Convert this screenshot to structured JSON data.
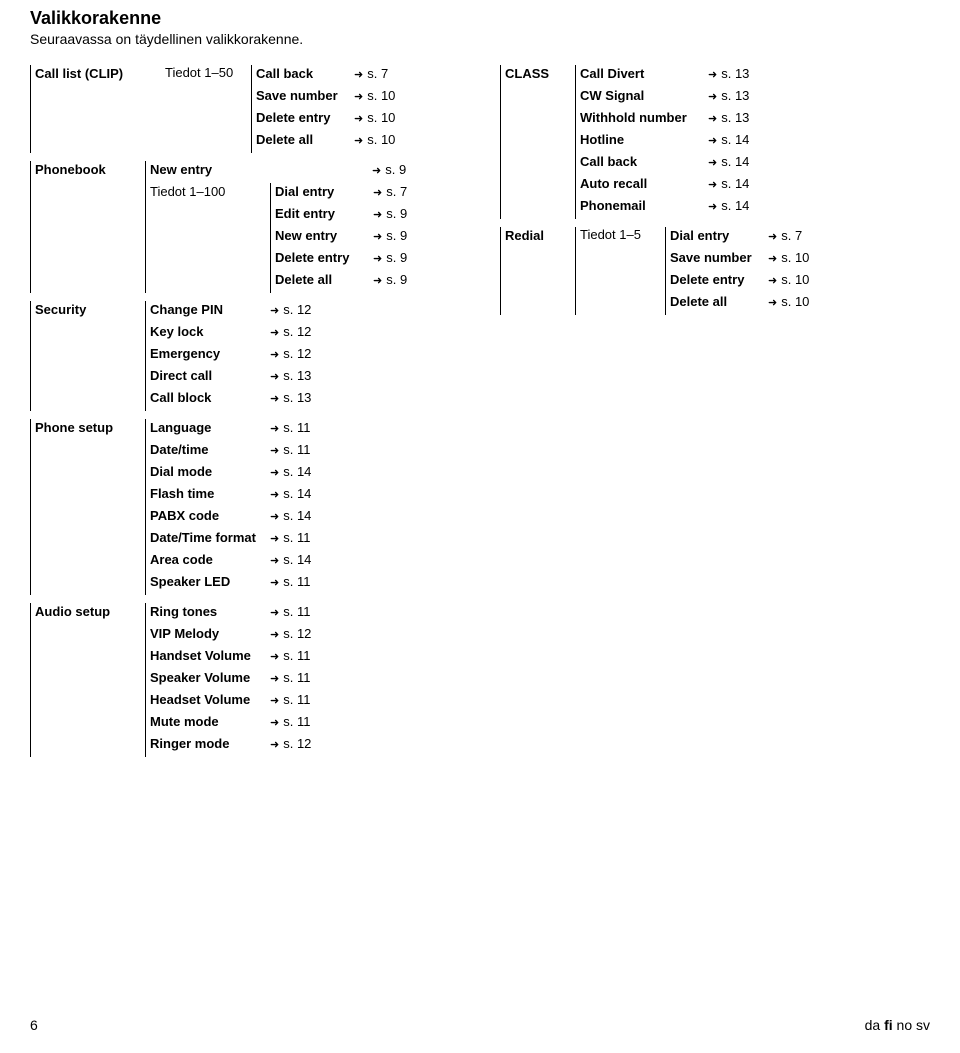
{
  "heading": "Valikkorakenne",
  "subheading": "Seuraavassa on täydellinen valikkorakenne.",
  "left": {
    "callList": {
      "label": "Call list (CLIP)",
      "range": "Tiedot 1–50",
      "items": [
        {
          "label": "Call back",
          "ref": "s. 7"
        },
        {
          "label": "Save number",
          "ref": "s. 10"
        },
        {
          "label": "Delete entry",
          "ref": "s. 10"
        },
        {
          "label": "Delete all",
          "ref": "s. 10"
        }
      ]
    },
    "phonebook": {
      "label": "Phonebook",
      "newEntry": {
        "label": "New entry",
        "ref": "s. 9"
      },
      "range": "Tiedot 1–100",
      "items": [
        {
          "label": "Dial entry",
          "ref": "s. 7"
        },
        {
          "label": "Edit entry",
          "ref": "s. 9"
        },
        {
          "label": "New entry",
          "ref": "s. 9"
        },
        {
          "label": "Delete entry",
          "ref": "s. 9"
        },
        {
          "label": "Delete all",
          "ref": "s. 9"
        }
      ]
    },
    "security": {
      "label": "Security",
      "items": [
        {
          "label": "Change PIN",
          "ref": "s. 12"
        },
        {
          "label": "Key lock",
          "ref": "s. 12"
        },
        {
          "label": "Emergency",
          "ref": "s. 12"
        },
        {
          "label": "Direct call",
          "ref": "s. 13"
        },
        {
          "label": "Call block",
          "ref": "s. 13"
        }
      ]
    },
    "phoneSetup": {
      "label": "Phone setup",
      "items": [
        {
          "label": "Language",
          "ref": "s. 11"
        },
        {
          "label": "Date/time",
          "ref": "s. 11"
        },
        {
          "label": "Dial mode",
          "ref": "s. 14"
        },
        {
          "label": "Flash time",
          "ref": "s. 14"
        },
        {
          "label": "PABX code",
          "ref": "s. 14"
        },
        {
          "label": "Date/Time format",
          "ref": "s. 11"
        },
        {
          "label": "Area code",
          "ref": "s. 14"
        },
        {
          "label": "Speaker LED",
          "ref": "s. 11"
        }
      ]
    },
    "audioSetup": {
      "label": "Audio setup",
      "items": [
        {
          "label": "Ring tones",
          "ref": "s. 11"
        },
        {
          "label": "VIP Melody",
          "ref": "s. 12"
        },
        {
          "label": "Handset Volume",
          "ref": "s. 11"
        },
        {
          "label": "Speaker Volume",
          "ref": "s. 11"
        },
        {
          "label": "Headset Volume",
          "ref": "s. 11"
        },
        {
          "label": "Mute mode",
          "ref": "s. 11"
        },
        {
          "label": "Ringer mode",
          "ref": "s. 12"
        }
      ]
    }
  },
  "right": {
    "class": {
      "label": "CLASS",
      "items": [
        {
          "label": "Call Divert",
          "ref": "s. 13"
        },
        {
          "label": "CW Signal",
          "ref": "s. 13"
        },
        {
          "label": "Withhold number",
          "ref": "s. 13"
        },
        {
          "label": "Hotline",
          "ref": "s. 14"
        },
        {
          "label": "Call back",
          "ref": "s. 14"
        },
        {
          "label": "Auto recall",
          "ref": "s. 14"
        },
        {
          "label": "Phonemail",
          "ref": "s. 14"
        }
      ]
    },
    "redial": {
      "label": "Redial",
      "range": "Tiedot 1–5",
      "items": [
        {
          "label": "Dial entry",
          "ref": "s. 7"
        },
        {
          "label": "Save number",
          "ref": "s. 10"
        },
        {
          "label": "Delete entry",
          "ref": "s. 10"
        },
        {
          "label": "Delete all",
          "ref": "s. 10"
        }
      ]
    }
  },
  "footer": {
    "pageNum": "6",
    "langs": [
      "da",
      "fi",
      "no",
      "sv"
    ],
    "selected": "fi"
  }
}
